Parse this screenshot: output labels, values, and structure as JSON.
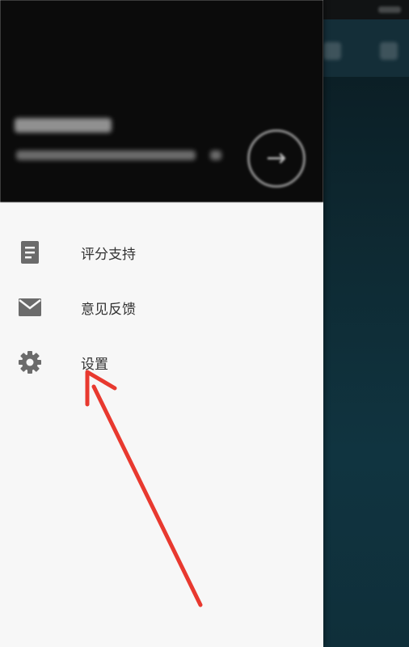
{
  "menu": {
    "items": [
      {
        "label": "评分支持",
        "icon": "document-icon"
      },
      {
        "label": "意见反馈",
        "icon": "mail-icon"
      },
      {
        "label": "设置",
        "icon": "gear-icon"
      }
    ]
  },
  "colors": {
    "accent_arrow": "#e8392f",
    "drawer_bg": "#f7f7f7",
    "header_bg": "#0b0b0b",
    "icon_gray": "#6b6b6b"
  }
}
